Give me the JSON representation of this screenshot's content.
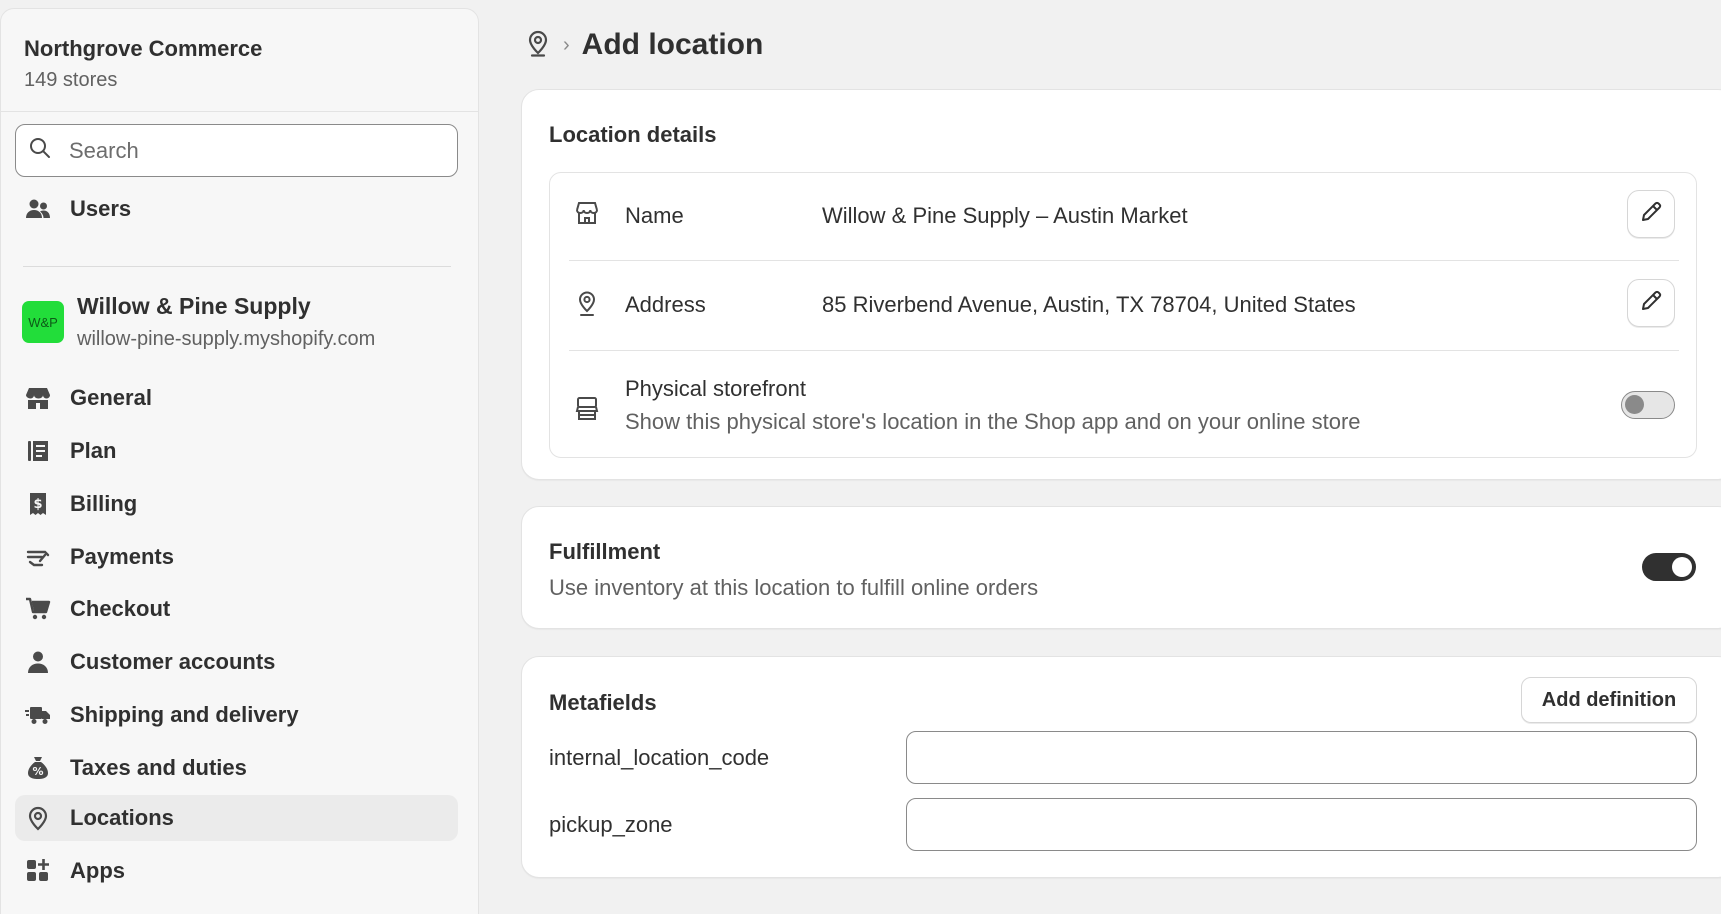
{
  "sidebar": {
    "org_name": "Northgrove Commerce",
    "org_count": "149 stores",
    "search_placeholder": "Search",
    "users_label": "Users",
    "store": {
      "badge": "W&P",
      "name": "Willow & Pine Supply",
      "url": "willow-pine-supply.myshopify.com"
    },
    "items": [
      {
        "label": "General",
        "icon": "store-icon"
      },
      {
        "label": "Plan",
        "icon": "plan-icon"
      },
      {
        "label": "Billing",
        "icon": "billing-icon"
      },
      {
        "label": "Payments",
        "icon": "payments-icon"
      },
      {
        "label": "Checkout",
        "icon": "cart-icon"
      },
      {
        "label": "Customer accounts",
        "icon": "person-icon"
      },
      {
        "label": "Shipping and delivery",
        "icon": "truck-icon"
      },
      {
        "label": "Taxes and duties",
        "icon": "money-bag-icon"
      },
      {
        "label": "Locations",
        "icon": "location-pin-icon",
        "active": true
      },
      {
        "label": "Apps",
        "icon": "apps-icon"
      }
    ]
  },
  "header": {
    "chevron": "›",
    "title": "Add location"
  },
  "location_details": {
    "title": "Location details",
    "name_label": "Name",
    "name_value": "Willow & Pine Supply – Austin Market",
    "address_label": "Address",
    "address_value": "85 Riverbend Avenue, Austin, TX 78704, United States",
    "storefront_label": "Physical storefront",
    "storefront_desc": "Show this physical store's location in the Shop app and on your online store",
    "storefront_enabled": false
  },
  "fulfillment": {
    "title": "Fulfillment",
    "desc": "Use inventory at this location to fulfill online orders",
    "enabled": true
  },
  "metafields": {
    "title": "Metafields",
    "add_label": "Add definition",
    "fields": [
      {
        "label": "internal_location_code",
        "value": ""
      },
      {
        "label": "pickup_zone",
        "value": ""
      }
    ]
  },
  "colors": {
    "accent_dark": "#303030",
    "store_badge": "#22dd3a",
    "active_nav": "#ebebeb"
  }
}
